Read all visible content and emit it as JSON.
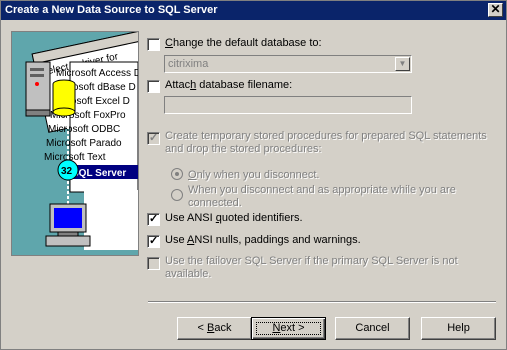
{
  "window": {
    "title": "Create a New Data Source to SQL Server"
  },
  "illustration": {
    "header": "Select a driver for",
    "drivers": [
      "Microsoft Access D",
      "Microsoft dBase D",
      "Microsoft Excel D",
      "Microsoft FoxPro",
      "Microsoft ODBC",
      "Microsoft Parado",
      "Microsoft Text",
      "SQL Server"
    ],
    "badge": "32"
  },
  "options": {
    "change_default_db": {
      "label_pre": "",
      "label_u": "C",
      "label_post": "hange the default database to:",
      "checked": false,
      "enabled": true
    },
    "default_db_value": "citrixima",
    "attach_filename": {
      "label_pre": "Attac",
      "label_u": "h",
      "label_post": " database filename:",
      "checked": false,
      "enabled": true
    },
    "attach_filename_value": "",
    "create_temp_sp": {
      "line1": "Create temporary stored procedures for prepared SQL statements",
      "line2": "and drop the stored procedures:",
      "checked": true,
      "enabled": false
    },
    "radio_disconnect": {
      "label_pre": "",
      "label_u": "O",
      "label_post": "nly when you disconnect.",
      "selected": true
    },
    "radio_appropriate": {
      "line1": "When you disconnect and as appropriate while you are",
      "line2": "connected.",
      "selected": false
    },
    "ansi_quoted": {
      "label_pre": "Use ANSI ",
      "label_u": "q",
      "label_post": "uoted identifiers.",
      "checked": true,
      "enabled": true
    },
    "ansi_nulls": {
      "label_pre": "Use ",
      "label_u": "A",
      "label_post": "NSI nulls, paddings and warnings.",
      "checked": true,
      "enabled": true
    },
    "failover": {
      "line1": "Use the failover SQL Server if the primary SQL Server is not",
      "line2": "available.",
      "checked": false,
      "enabled": false
    }
  },
  "buttons": {
    "back": {
      "pre": "< ",
      "u": "B",
      "post": "ack"
    },
    "next": {
      "pre": "",
      "u": "N",
      "post": "ext >"
    },
    "cancel": "Cancel",
    "help": "Help"
  },
  "colors": {
    "title_bar": "#0a246a",
    "dialog_bg": "#d4d0c8",
    "illustration_bg": "#5fa6ac"
  }
}
